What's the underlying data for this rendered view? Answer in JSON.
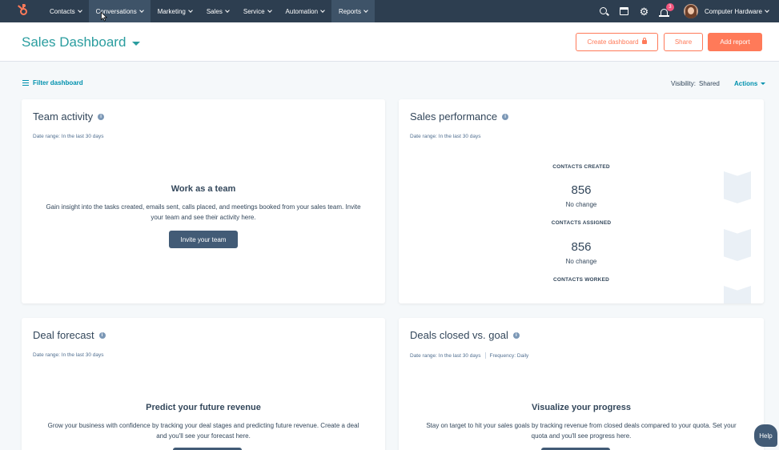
{
  "nav": {
    "items": [
      "Contacts",
      "Conversations",
      "Marketing",
      "Sales",
      "Service",
      "Automation",
      "Reports"
    ],
    "badge_count": "3",
    "account_name": "Computer Hardware"
  },
  "header": {
    "title": "Sales Dashboard",
    "create_dashboard": "Create dashboard",
    "share": "Share",
    "add_report": "Add report"
  },
  "toolbar": {
    "filter": "Filter dashboard",
    "visibility_label": "Visibility:",
    "visibility_value": "Shared",
    "actions": "Actions"
  },
  "cards": {
    "team_activity": {
      "title": "Team activity",
      "date_range": "Date range: In the last 30 days",
      "empty_title": "Work as a team",
      "empty_desc": "Gain insight into the tasks created, emails sent, calls placed, and meetings booked from your sales team. Invite your team and see their activity here.",
      "button": "Invite your team"
    },
    "sales_performance": {
      "title": "Sales performance",
      "date_range": "Date range: In the last 30 days",
      "metrics": [
        {
          "label": "CONTACTS CREATED",
          "value": "856",
          "change": "No change"
        },
        {
          "label": "CONTACTS ASSIGNED",
          "value": "856",
          "change": "No change"
        },
        {
          "label": "CONTACTS WORKED"
        }
      ]
    },
    "deal_forecast": {
      "title": "Deal forecast",
      "date_range": "Date range: In the last 30 days",
      "empty_title": "Predict your future revenue",
      "empty_desc": "Grow your business with confidence by tracking your deal stages and predicting future revenue. Create a deal and you'll see your forecast here."
    },
    "deals_closed": {
      "title": "Deals closed vs. goal",
      "date_range": "Date range: In the last 30 days",
      "frequency": "Frequency: Daily",
      "empty_title": "Visualize your progress",
      "empty_desc": "Stay on target to hit your sales goals by tracking revenue from closed deals compared to your quota. Set your quota and you'll see progress here."
    }
  },
  "help": "Help",
  "colors": {
    "nav_bg": "#2d3e50",
    "accent": "#ff7a59",
    "teal": "#2a9d9f",
    "link": "#0091ae",
    "dark_button": "#425b76"
  }
}
